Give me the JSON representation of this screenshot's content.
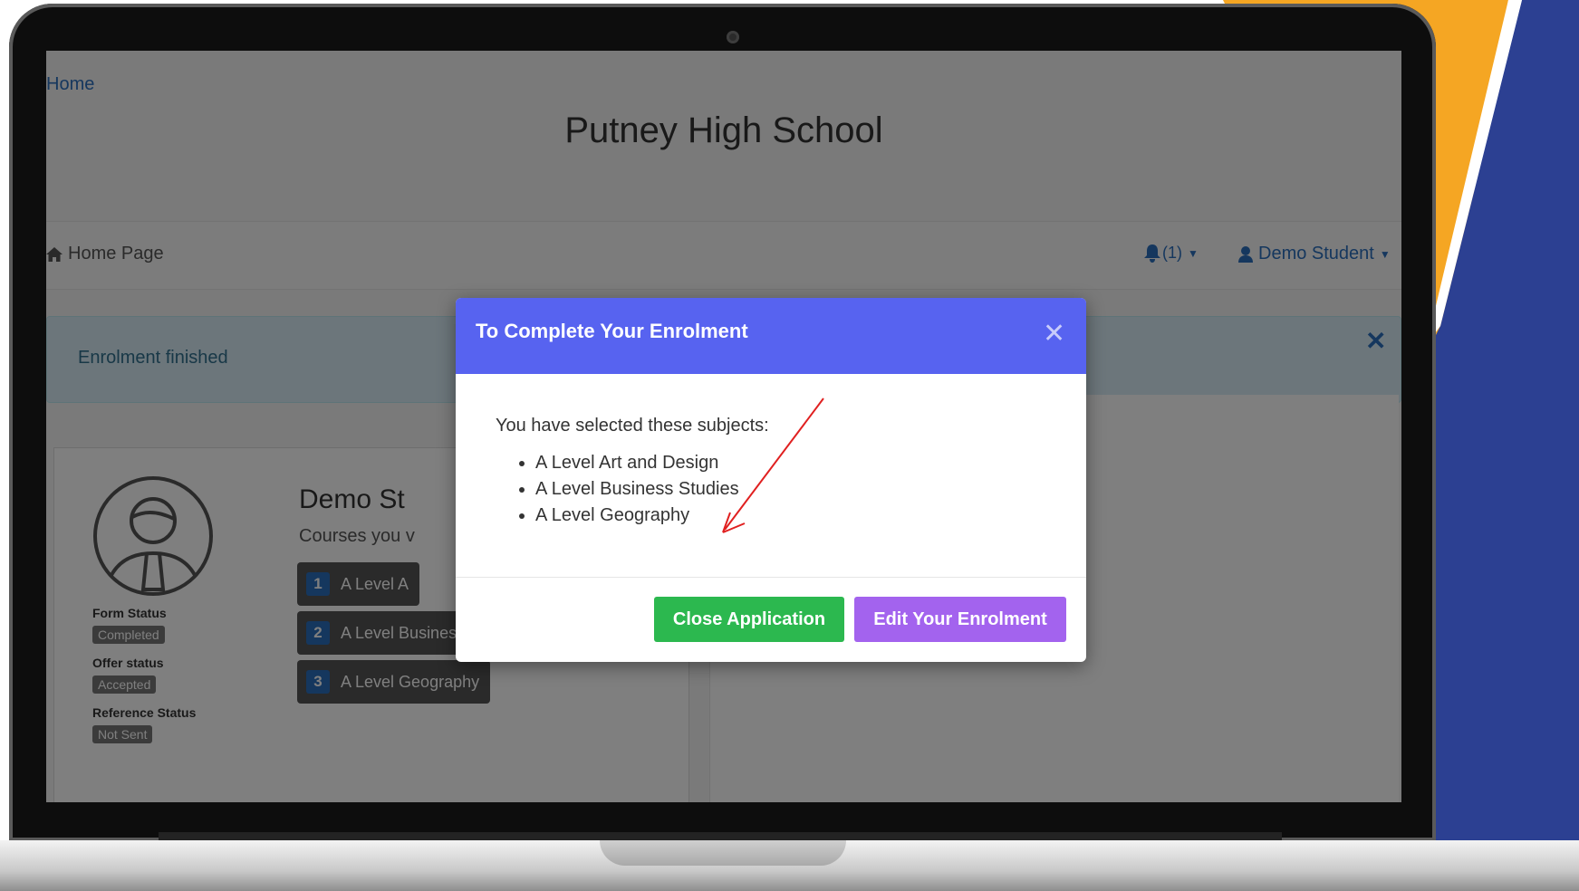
{
  "colors": {
    "yellow_accent": "#f5a623",
    "blue_accent": "#2c4092",
    "modal_header": "#5763f0",
    "close_button": "#2cb84f",
    "edit_button": "#a363ee",
    "link_blue": "#2a6ebd",
    "annotation_arrow": "#e02020"
  },
  "breadcrumb": {
    "home": "Home"
  },
  "header": {
    "school_name": "Putney High School"
  },
  "navbar": {
    "home_label": "Home Page",
    "notifications": "(1)",
    "user_label": "Demo Student"
  },
  "alert": {
    "text": "Enrolment finished"
  },
  "profile": {
    "name": "Demo St",
    "courses_text": "Courses you v",
    "statuses": [
      {
        "label": "Form Status",
        "value": "Completed"
      },
      {
        "label": "Offer status",
        "value": "Accepted"
      },
      {
        "label": "Reference Status",
        "value": "Not Sent"
      }
    ],
    "courses": [
      {
        "num": "1",
        "name": "A Level A"
      },
      {
        "num": "2",
        "name": "A Level Business Studies"
      },
      {
        "num": "3",
        "name": "A Level Geography"
      }
    ]
  },
  "modal": {
    "title": "To Complete Your Enrolment",
    "intro": "You have selected these subjects:",
    "subjects": [
      "A Level Art and Design",
      "A Level Business Studies",
      "A Level Geography"
    ],
    "close_application": "Close Application",
    "edit_enrolment": "Edit Your Enrolment"
  }
}
